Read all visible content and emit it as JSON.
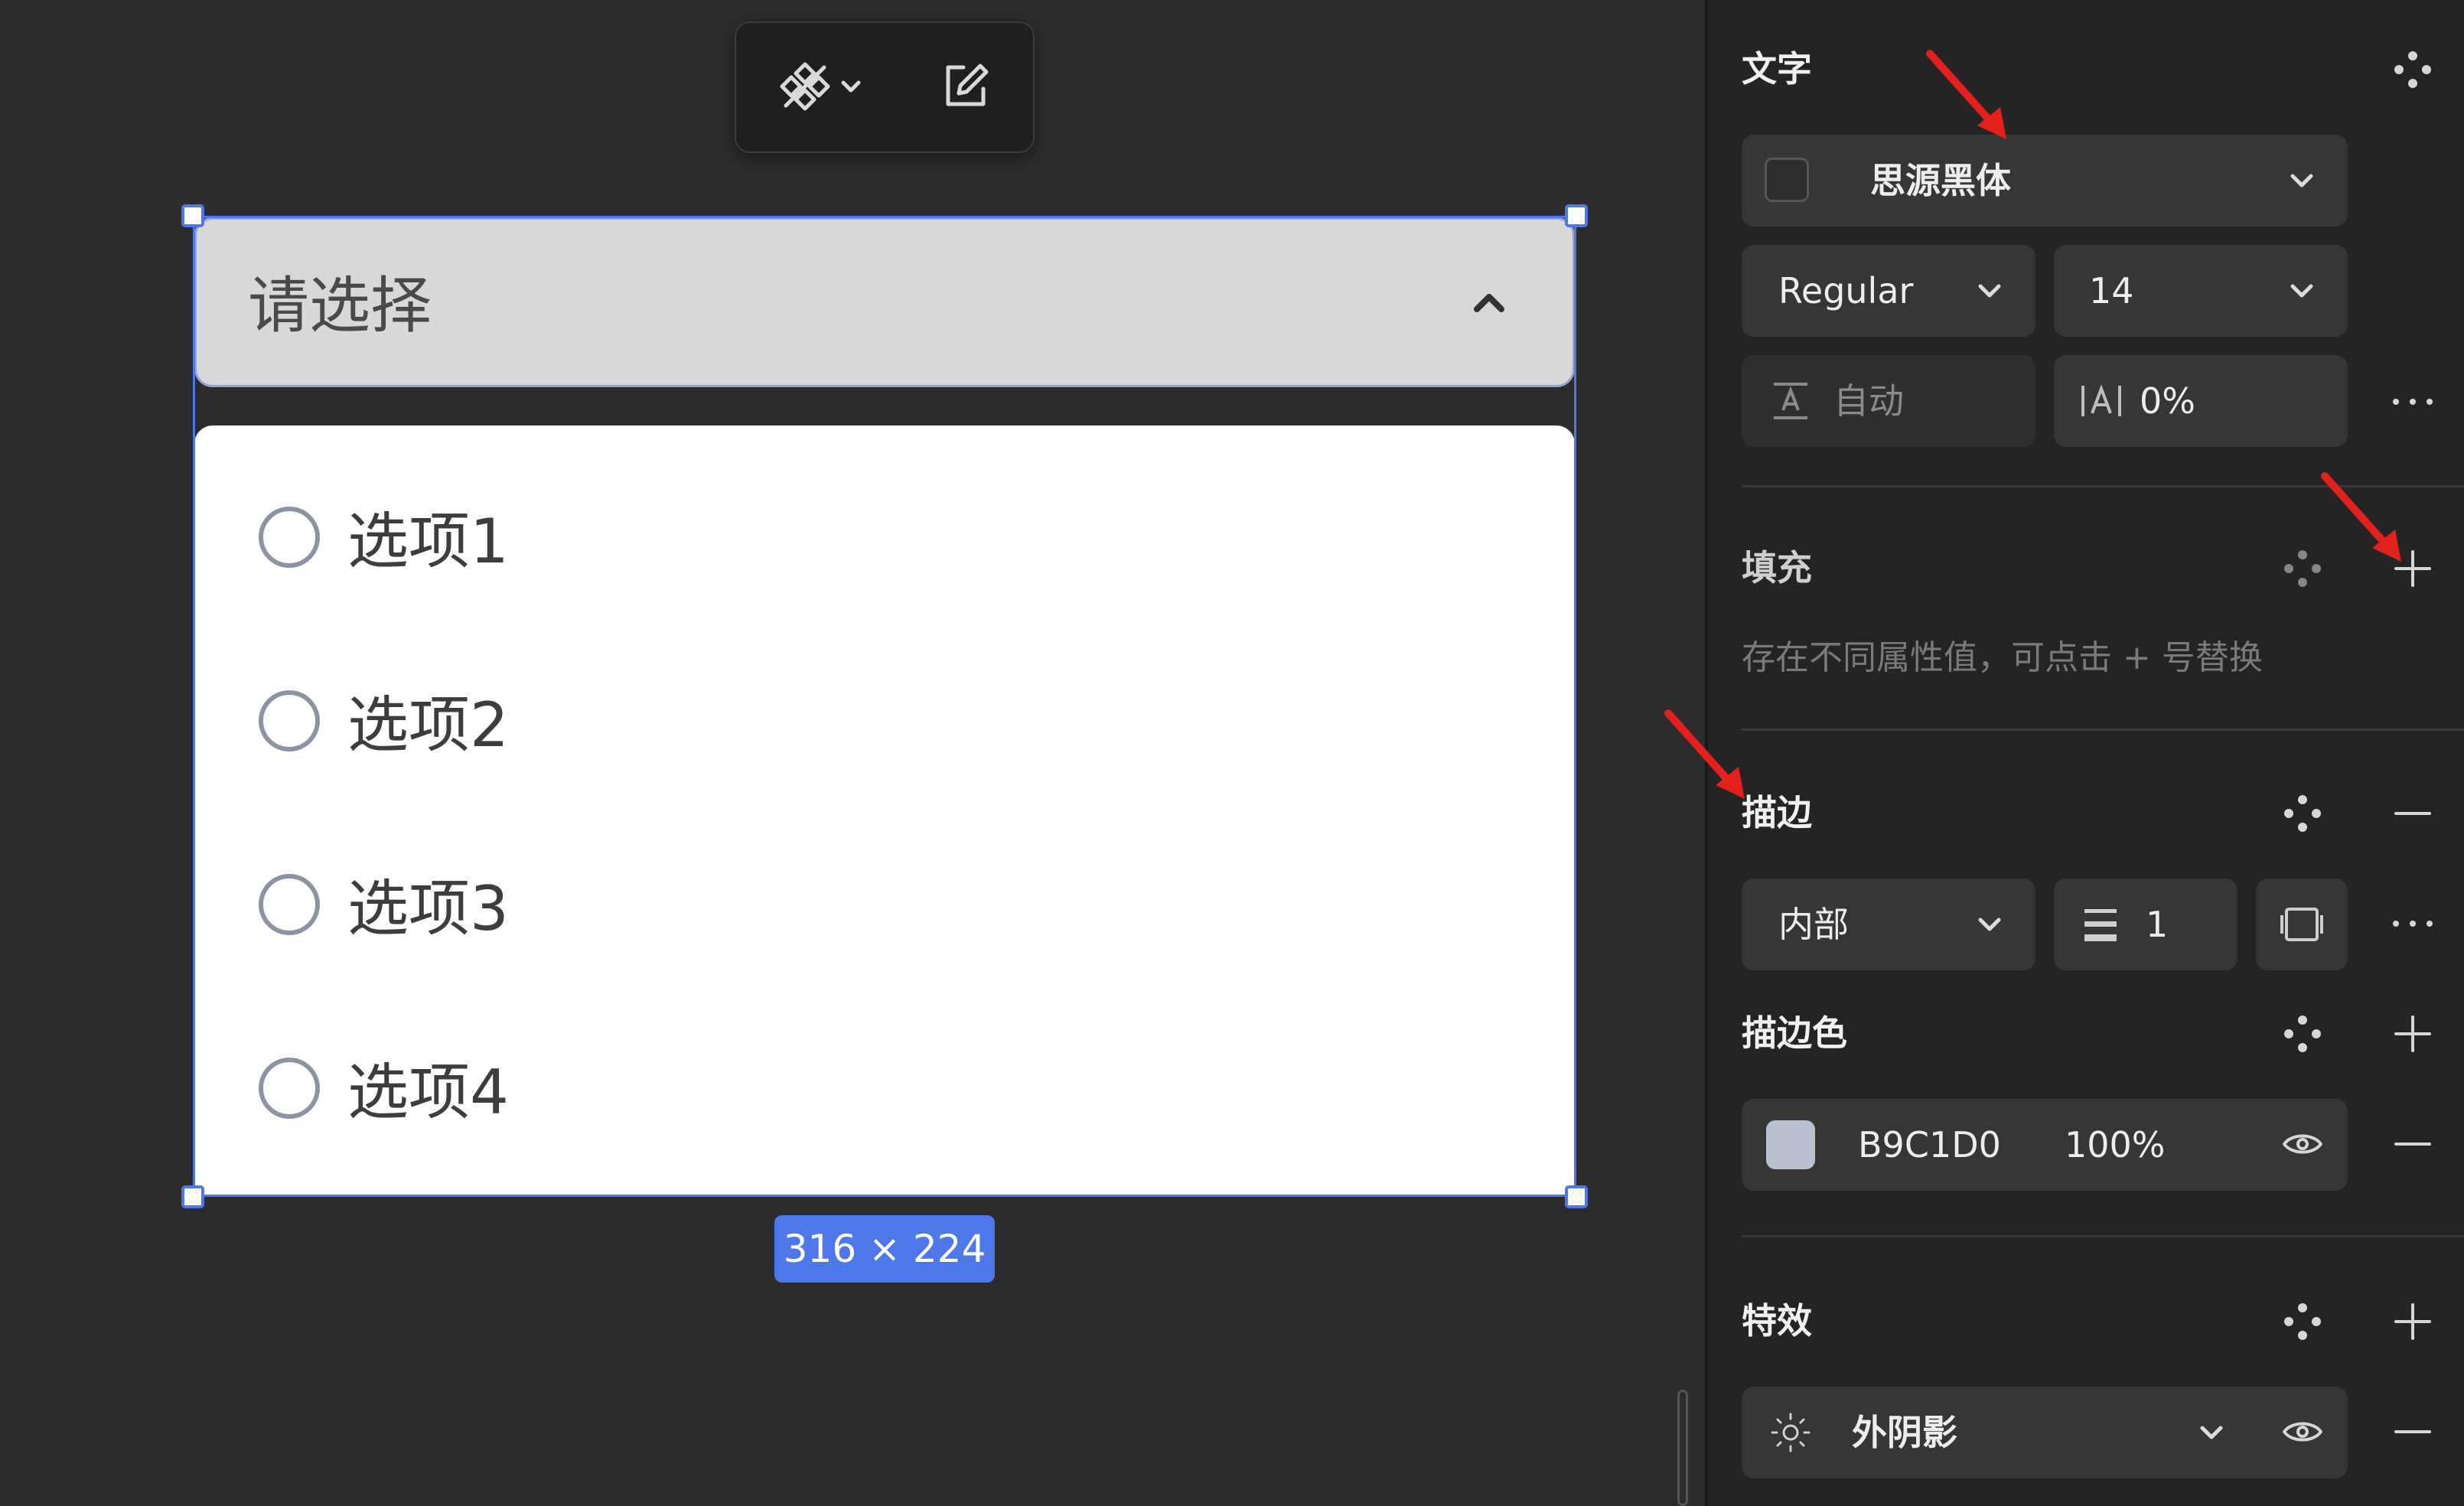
{
  "toolbar": {
    "components_icon": "components-icon",
    "dropdown_icon": "chevron-down-icon",
    "edit_icon": "edit-icon"
  },
  "select": {
    "placeholder": "请选择",
    "expanded_icon": "chevron-up-icon",
    "options": [
      {
        "label": "选项1"
      },
      {
        "label": "选项2"
      },
      {
        "label": "选项3"
      },
      {
        "label": "选项4"
      }
    ]
  },
  "size_badge": "316 × 224",
  "panel": {
    "text": {
      "title": "文字",
      "font_family": "思源黑体",
      "font_weight": "Regular",
      "font_size": "14",
      "line_height": "自动",
      "letter_spacing": "0%"
    },
    "fill": {
      "title": "填充",
      "mixed_hint": "存在不同属性值，可点击 + 号替换"
    },
    "stroke": {
      "title": "描边",
      "position": "内部",
      "width": "1"
    },
    "stroke_color": {
      "title": "描边色",
      "hex": "B9C1D0",
      "opacity": "100%",
      "swatch": "#B9C1D0"
    },
    "effects": {
      "title": "特效",
      "type": "外阴影"
    }
  },
  "colors": {
    "selection": "#4E78EA",
    "annotation_arrow": "#E3201B",
    "panel_bg": "#242424",
    "canvas_bg": "#2C2C2C"
  }
}
